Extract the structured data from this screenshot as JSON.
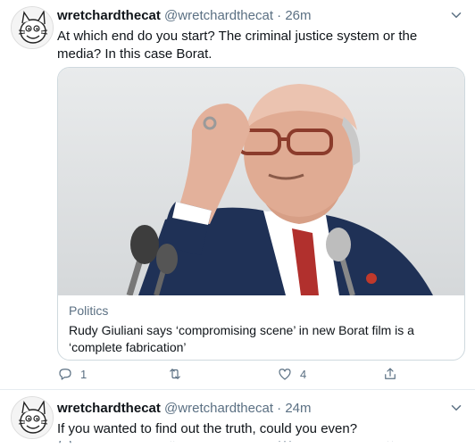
{
  "tweets": [
    {
      "display_name": "wretchardthecat",
      "handle": "@wretchardthecat",
      "separator": "·",
      "time": "26m",
      "text": "At which end do you start? The criminal justice system or the media?  In this case Borat.",
      "card": {
        "source": "Politics",
        "title": "Rudy Giuliani says ‘compromising scene’ in new Borat film is a ‘complete fabrication’"
      },
      "actions": {
        "reply_count": "1",
        "retweet_count": "",
        "like_count": "4"
      }
    },
    {
      "display_name": "wretchardthecat",
      "handle": "@wretchardthecat",
      "separator": "·",
      "time": "24m",
      "text": "If you wanted to find out the truth, could you even?"
    }
  ],
  "icons": {
    "reply": "reply-icon",
    "retweet": "retweet-icon",
    "like": "heart-icon",
    "share": "share-icon",
    "more": "chevron-down-icon"
  },
  "colors": {
    "text": "#0f1419",
    "secondary": "#5b7083",
    "border": "#cfd9de"
  }
}
